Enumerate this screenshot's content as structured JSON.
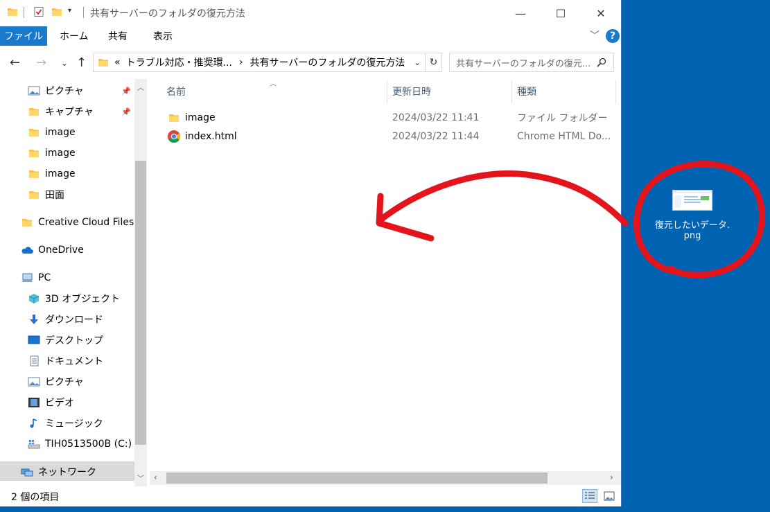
{
  "window": {
    "title": "共有サーバーのフォルダの復元方法",
    "controls": {
      "minimize": "—",
      "maximize": "☐",
      "close": "✕"
    }
  },
  "ribbon": {
    "tabs": [
      "ファイル",
      "ホーム",
      "共有",
      "表示"
    ],
    "help": "?"
  },
  "address": {
    "overflow": "«",
    "segments": [
      "トラブル対応・推奨環...",
      "共有サーバーのフォルダの復元方法"
    ],
    "separator": "›",
    "search_placeholder": "共有サーバーのフォルダの復元..."
  },
  "sidebar": {
    "items": [
      {
        "label": "ピクチャ",
        "icon": "pictures-icon",
        "pinned": true
      },
      {
        "label": "キャプチャ",
        "icon": "folder-icon",
        "pinned": true
      },
      {
        "label": "image",
        "icon": "folder-icon"
      },
      {
        "label": "image",
        "icon": "folder-icon"
      },
      {
        "label": "image",
        "icon": "folder-icon"
      },
      {
        "label": "田面",
        "icon": "folder-icon"
      },
      {
        "label": "Creative Cloud Files F",
        "icon": "folder-icon"
      },
      {
        "label": "OneDrive",
        "icon": "cloud-icon"
      },
      {
        "label": "PC",
        "icon": "pc-icon"
      },
      {
        "label": "3D オブジェクト",
        "icon": "3d-objects-icon"
      },
      {
        "label": "ダウンロード",
        "icon": "download-icon"
      },
      {
        "label": "デスクトップ",
        "icon": "desktop-icon"
      },
      {
        "label": "ドキュメント",
        "icon": "document-icon"
      },
      {
        "label": "ピクチャ",
        "icon": "pictures-icon"
      },
      {
        "label": "ビデオ",
        "icon": "video-icon"
      },
      {
        "label": "ミュージック",
        "icon": "music-icon"
      },
      {
        "label": "TIH0513500B (C:)",
        "icon": "drive-icon"
      },
      {
        "label": "ネットワーク",
        "icon": "network-icon",
        "selected": true
      }
    ]
  },
  "columns": {
    "name": "名前",
    "modified": "更新日時",
    "type": "種類"
  },
  "files": [
    {
      "name": "image",
      "modified": "2024/03/22 11:41",
      "type": "ファイル フォルダー",
      "icon": "folder-icon"
    },
    {
      "name": "index.html",
      "modified": "2024/03/22 11:44",
      "type": "Chrome HTML Do...",
      "icon": "chrome-icon"
    }
  ],
  "status": {
    "count": "2 個の項目"
  },
  "desktop_icon": {
    "line1": "復元したいデータ.",
    "line2": "png"
  },
  "colors": {
    "accent": "#1979ca",
    "desktop": "#0063b1",
    "annotation": "#e3141c",
    "folder": "#f5c342"
  }
}
